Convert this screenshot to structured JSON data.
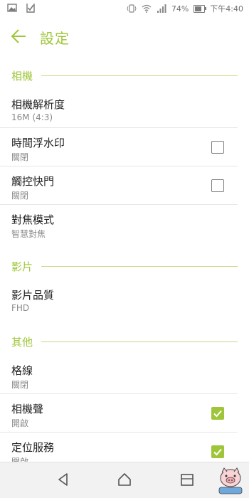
{
  "status_bar": {
    "battery": "74%",
    "time": "下午4:40",
    "left_icons": [
      "image-icon",
      "check-badge-icon"
    ],
    "right_icons": [
      "vibrate-icon",
      "wifi-icon",
      "signal-icon",
      "battery-icon"
    ],
    "battery_level": 0.74
  },
  "header": {
    "title": "設定",
    "back_icon": "arrow-left-icon"
  },
  "sections": {
    "camera": {
      "title": "相機",
      "items": [
        {
          "label": "相機解析度",
          "value": "16M (4:3)"
        },
        {
          "label": "時間浮水印",
          "value": "關閉",
          "checked": false
        },
        {
          "label": "觸控快門",
          "value": "關閉",
          "checked": false
        },
        {
          "label": "對焦模式",
          "value": "智慧對焦"
        }
      ]
    },
    "video": {
      "title": "影片",
      "items": [
        {
          "label": "影片品質",
          "value": "FHD"
        }
      ]
    },
    "other": {
      "title": "其他",
      "items": [
        {
          "label": "格線",
          "value": "關閉"
        },
        {
          "label": "相機聲",
          "value": "開啟",
          "checked": true
        },
        {
          "label": "定位服務",
          "value": "開啟",
          "checked": true
        }
      ]
    }
  },
  "colors": {
    "accent": "#9fc63a",
    "divider": "#e6e6e6",
    "navbar": "#f2f2f2"
  },
  "nav_bar": {
    "icons": [
      "back-triangle-icon",
      "home-icon",
      "recents-icon"
    ]
  }
}
